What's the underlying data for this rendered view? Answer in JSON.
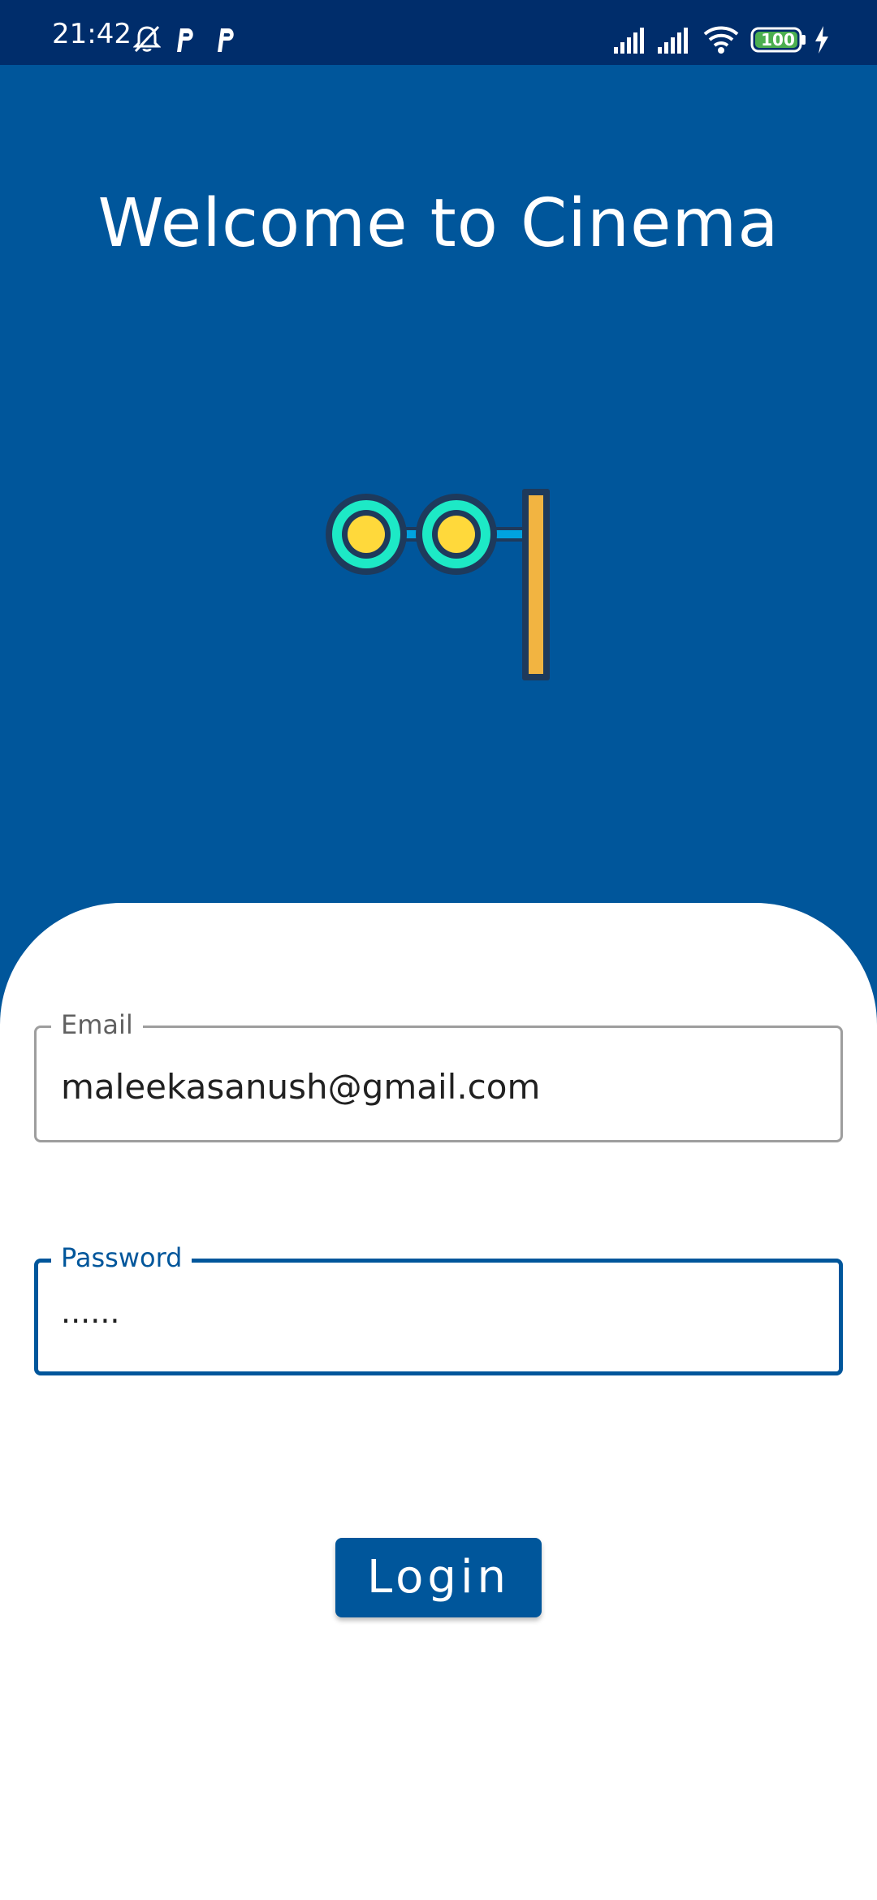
{
  "status_bar": {
    "time": "21:42",
    "battery": "100",
    "icons": [
      "bell-off-icon",
      "parking-icon",
      "parking-icon",
      "signal-icon",
      "signal-icon",
      "wifi-icon",
      "battery-icon",
      "charging-icon"
    ]
  },
  "header": {
    "title": "Welcome to Cinema",
    "logo": "traffic-signal-icon"
  },
  "form": {
    "email": {
      "label": "Email",
      "value": "maleekasanush@gmail.com"
    },
    "password": {
      "label": "Password",
      "value": "......"
    },
    "login_label": "Login"
  },
  "colors": {
    "primary": "#00569b",
    "status_bar": "#002d6b",
    "surface": "#ffffff"
  }
}
